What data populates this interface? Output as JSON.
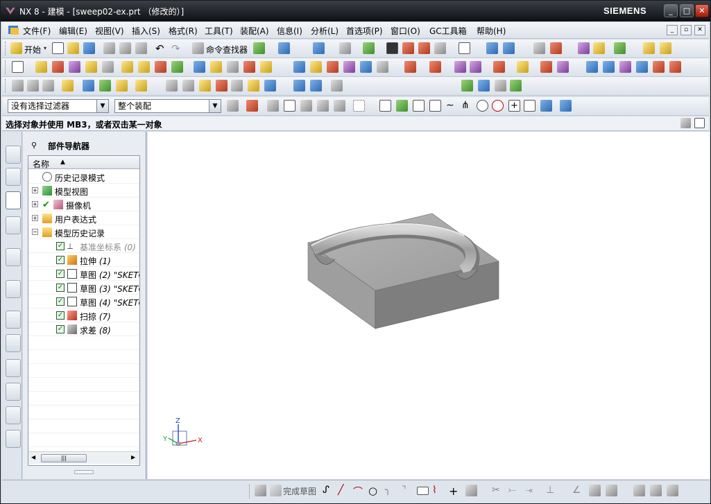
{
  "window": {
    "title": "NX 8 - 建模 - [sweep02-ex.prt （修改的）]",
    "brand": "SIEMENS",
    "min": "_",
    "max": "□",
    "close": "✕"
  },
  "menubar": {
    "items": [
      "文件(F)",
      "编辑(E)",
      "视图(V)",
      "插入(S)",
      "格式(R)",
      "工具(T)",
      "装配(A)",
      "信息(I)",
      "分析(L)",
      "首选项(P)",
      "窗口(O)",
      "GC工具箱",
      "帮助(H)"
    ]
  },
  "toolbar": {
    "start_label": "开始",
    "command_finder_label": "命令查找器"
  },
  "filterbar": {
    "selection_filter": "没有选择过滤器",
    "assembly_scope": "整个装配"
  },
  "status": {
    "prompt": "选择对象并使用 MB3，或者双击某一对象"
  },
  "navigator": {
    "title": "部件导航器",
    "column_header": "名称",
    "items": [
      {
        "label": "历史记录模式",
        "num": ""
      },
      {
        "label": "模型视图",
        "num": ""
      },
      {
        "label": "摄像机",
        "num": ""
      },
      {
        "label": "用户表达式",
        "num": ""
      },
      {
        "label": "模型历史记录",
        "num": ""
      },
      {
        "label": "基准坐标系",
        "num": "(0)"
      },
      {
        "label": "拉伸",
        "num": "(1)"
      },
      {
        "label": "草图",
        "num": "(2) \"SKETC"
      },
      {
        "label": "草图",
        "num": "(3) \"SKETC"
      },
      {
        "label": "草图",
        "num": "(4) \"SKETC"
      },
      {
        "label": "扫掠",
        "num": "(7)"
      },
      {
        "label": "求差",
        "num": "(8)"
      }
    ]
  },
  "triad": {
    "x": "X",
    "y": "Y",
    "z": "Z"
  },
  "bottombar": {
    "finish_sketch": "完成草图"
  },
  "colors": {
    "titlebar": "#1a1d21",
    "panel": "#e9edf2",
    "model": "#8c8c8c"
  }
}
